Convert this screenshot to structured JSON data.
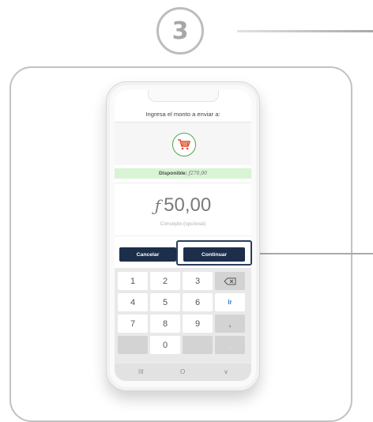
{
  "step": {
    "number": "3"
  },
  "phone": {
    "header": "Ingresa el monto a enviar a:",
    "merchant_icon": "shopping-cart-icon",
    "available": {
      "label": "Disponible:",
      "value": "ƒ270,00"
    },
    "amount": {
      "currency": "ƒ",
      "value": "50,00"
    },
    "concept_placeholder": "Concepto (opcional)",
    "buttons": {
      "cancel": "Cancelar",
      "continue": "Continuar"
    },
    "keypad": {
      "k1": "1",
      "k2": "2",
      "k3": "3",
      "k4": "4",
      "k5": "5",
      "k6": "6",
      "ir": "Ir",
      "k7": "7",
      "k8": "8",
      "k9": "9",
      "comma": ",",
      "k0": "0",
      "dot": "."
    },
    "nav": {
      "recents": "III",
      "home": "O",
      "back": "∨"
    }
  },
  "colors": {
    "button_bg": "#1c2e4a",
    "available_bg": "#d8f4d4",
    "cart_accent": "#4ea44e",
    "ir_color": "#2f7ed8"
  }
}
